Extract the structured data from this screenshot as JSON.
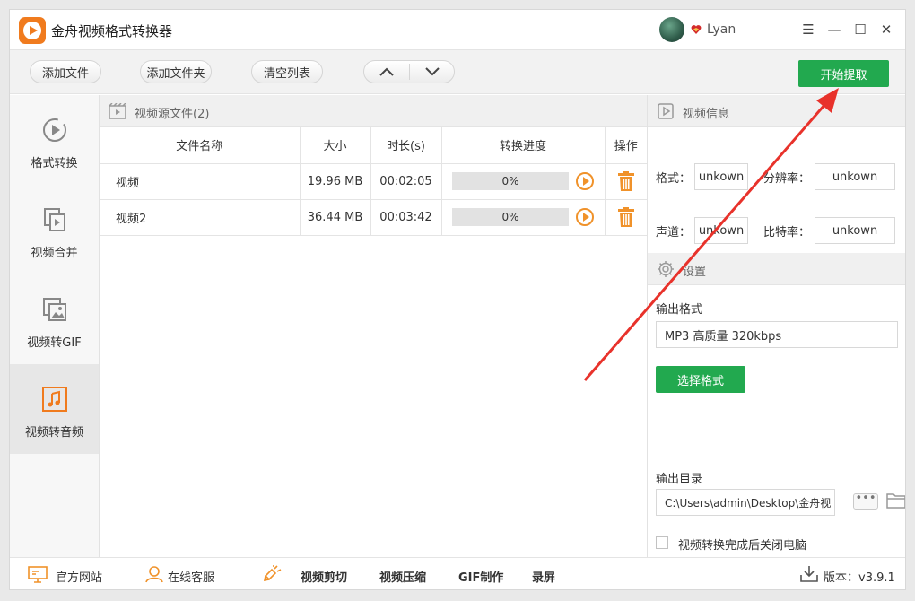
{
  "app": {
    "title": "金舟视频格式转换器"
  },
  "user": {
    "name": "Lyan"
  },
  "window_controls": {
    "menu": "☰",
    "minimize": "—",
    "maximize": "☐",
    "close": "✕"
  },
  "toolbar": {
    "add_file": "添加文件",
    "add_folder": "添加文件夹",
    "clear_list": "清空列表",
    "move_up": "︿",
    "move_down": "﹀",
    "start": "开始提取"
  },
  "sidebar": {
    "items": [
      {
        "label": "格式转换",
        "icon": "convert-icon"
      },
      {
        "label": "视频合并",
        "icon": "merge-icon"
      },
      {
        "label": "视频转GIF",
        "icon": "gif-icon"
      },
      {
        "label": "视频转音频",
        "icon": "music-icon",
        "active": true
      }
    ]
  },
  "file_list": {
    "title": "视频源文件(2)",
    "columns": [
      "文件名称",
      "大小",
      "时长(s)",
      "转换进度",
      "操作"
    ],
    "rows": [
      {
        "name": "视频",
        "size": "19.96 MB",
        "duration": "00:02:05",
        "progress_text": "0%",
        "progress": 0
      },
      {
        "name": "视频2",
        "size": "36.44 MB",
        "duration": "00:03:42",
        "progress_text": "0%",
        "progress": 0
      }
    ]
  },
  "video_info": {
    "title": "视频信息",
    "format_label": "格式：",
    "format_value": "unkown",
    "resolution_label": "分辨率：",
    "resolution_value": "unkown",
    "channel_label": "声道：",
    "channel_value": "unkown",
    "bitrate_label": "比特率：",
    "bitrate_value": "unkown"
  },
  "settings": {
    "title": "设置",
    "output_format_label": "输出格式",
    "output_format_value": "MP3 高质量 320kbps",
    "choose_format": "选择格式",
    "output_dir_label": "输出目录",
    "output_dir_value": "C:\\Users\\admin\\Desktop\\金舟视",
    "browse": "•••",
    "shutdown_label": "视频转换完成后关闭电脑"
  },
  "bottom": {
    "website": "官方网站",
    "support": "在线客服",
    "clip": "视频剪切",
    "compress": "视频压缩",
    "gif": "GIF制作",
    "record": "录屏",
    "version": "版本：v3.9.1"
  },
  "colors": {
    "accent_green": "#22a94f",
    "orange": "#f0922a",
    "annotation_red": "#e8322b"
  }
}
